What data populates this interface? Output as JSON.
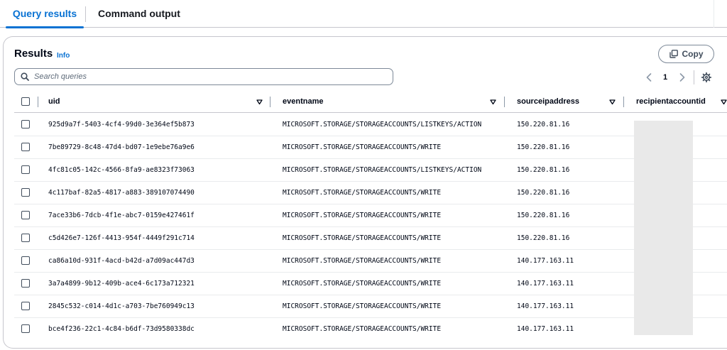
{
  "tabs": [
    {
      "label": "Query results",
      "active": true
    },
    {
      "label": "Command output",
      "active": false
    }
  ],
  "panel": {
    "title": "Results",
    "info": "Info",
    "copy_label": "Copy"
  },
  "search": {
    "placeholder": "Search queries",
    "value": ""
  },
  "pagination": {
    "current_page": "1"
  },
  "table": {
    "columns": [
      "uid",
      "eventname",
      "sourceipaddress",
      "recipientaccountid"
    ],
    "rows": [
      {
        "uid": "925d9a7f-5403-4cf4-99d0-3e364ef5b873",
        "eventname": "MICROSOFT.STORAGE/STORAGEACCOUNTS/LISTKEYS/ACTION",
        "sourceipaddress": "150.220.81.16",
        "recipientaccountid": ""
      },
      {
        "uid": "7be89729-8c48-47d4-bd07-1e9ebe76a9e6",
        "eventname": "MICROSOFT.STORAGE/STORAGEACCOUNTS/WRITE",
        "sourceipaddress": "150.220.81.16",
        "recipientaccountid": ""
      },
      {
        "uid": "4fc81c05-142c-4566-8fa9-ae8323f73063",
        "eventname": "MICROSOFT.STORAGE/STORAGEACCOUNTS/LISTKEYS/ACTION",
        "sourceipaddress": "150.220.81.16",
        "recipientaccountid": ""
      },
      {
        "uid": "4c117baf-82a5-4817-a883-389107074490",
        "eventname": "MICROSOFT.STORAGE/STORAGEACCOUNTS/WRITE",
        "sourceipaddress": "150.220.81.16",
        "recipientaccountid": ""
      },
      {
        "uid": "7ace33b6-7dcb-4f1e-abc7-0159e427461f",
        "eventname": "MICROSOFT.STORAGE/STORAGEACCOUNTS/WRITE",
        "sourceipaddress": "150.220.81.16",
        "recipientaccountid": ""
      },
      {
        "uid": "c5d426e7-126f-4413-954f-4449f291c714",
        "eventname": "MICROSOFT.STORAGE/STORAGEACCOUNTS/WRITE",
        "sourceipaddress": "150.220.81.16",
        "recipientaccountid": ""
      },
      {
        "uid": "ca86a10d-931f-4acd-b42d-a7d09ac447d3",
        "eventname": "MICROSOFT.STORAGE/STORAGEACCOUNTS/WRITE",
        "sourceipaddress": "140.177.163.11",
        "recipientaccountid": ""
      },
      {
        "uid": "3a7a4899-9b12-409b-ace4-6c173a712321",
        "eventname": "MICROSOFT.STORAGE/STORAGEACCOUNTS/WRITE",
        "sourceipaddress": "140.177.163.11",
        "recipientaccountid": ""
      },
      {
        "uid": "2845c532-c014-4d1c-a703-7be760949c13",
        "eventname": "MICROSOFT.STORAGE/STORAGEACCOUNTS/WRITE",
        "sourceipaddress": "140.177.163.11",
        "recipientaccountid": ""
      },
      {
        "uid": "bce4f236-22c1-4c84-b6df-73d9580338dc",
        "eventname": "MICROSOFT.STORAGE/STORAGEACCOUNTS/WRITE",
        "sourceipaddress": "140.177.163.11",
        "recipientaccountid": ""
      }
    ]
  },
  "icons": {
    "copy": "copy-icon",
    "search": "search-icon",
    "prev": "chevron-left-icon",
    "next": "chevron-right-icon",
    "settings": "gear-icon",
    "sort": "sort-down-icon"
  },
  "colors": {
    "accent": "#0972d3",
    "text": "#000716",
    "border": "#c6c6cd",
    "redaction": "#e9e9e9"
  }
}
